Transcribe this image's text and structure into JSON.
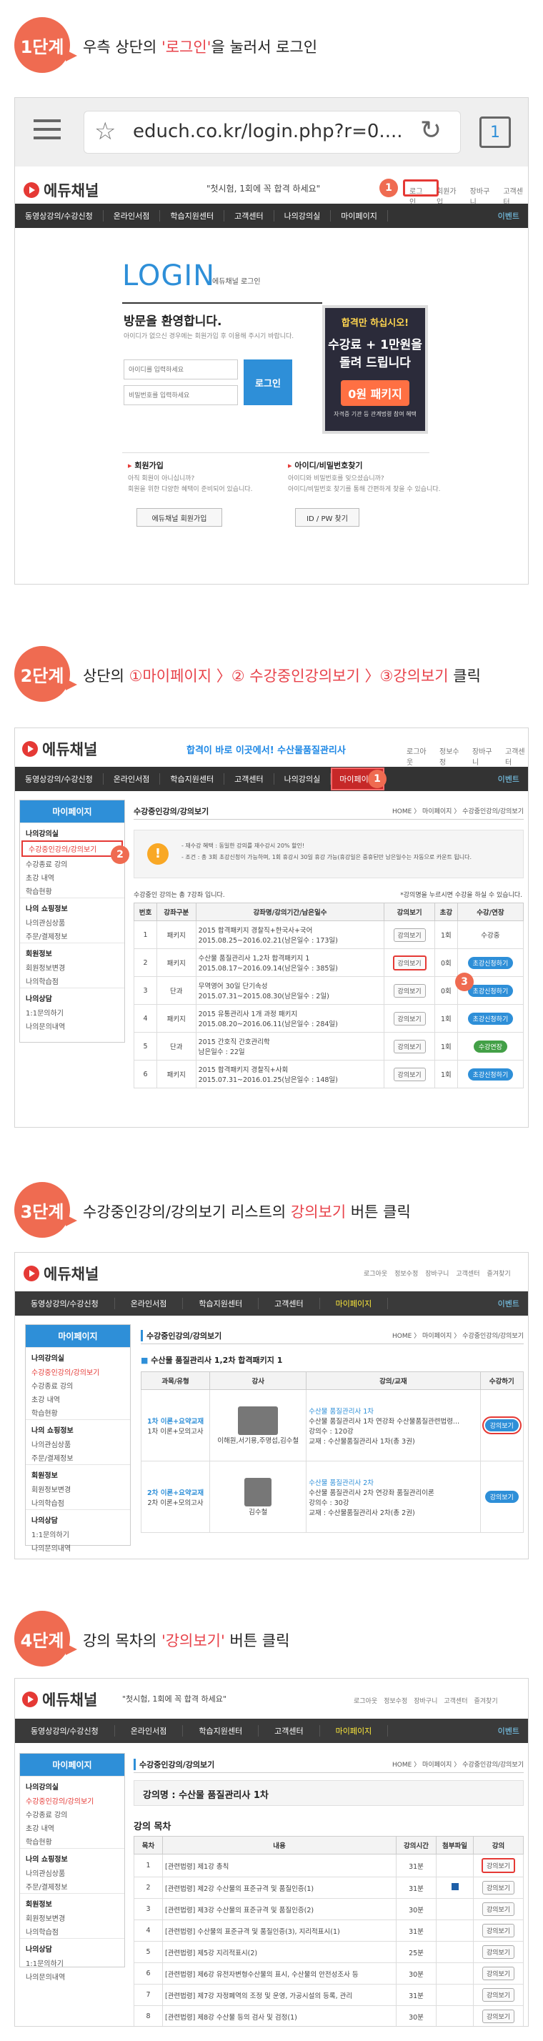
{
  "steps": [
    {
      "num": "1단계",
      "pre": "우측 상단의 ",
      "hl": "'로그인'",
      "post": "을 눌러서 로그인"
    },
    {
      "num": "2단계",
      "pre": "상단의 ",
      "hl": "①마이페이지 〉② 수강중인강의보기 〉③강의보기",
      "post": " 클릭"
    },
    {
      "num": "3단계",
      "pre": "수강중인강의/강의보기 리스트의 ",
      "hl": "강의보기",
      "post": " 버튼 클릭"
    },
    {
      "num": "4단계",
      "pre": "강의 목차의 ",
      "hl": "'강의보기'",
      "post": " 버튼 클릭"
    }
  ],
  "s1": {
    "url": "educh.co.kr/login.php?r=0....",
    "tabcount": "1",
    "logo": "에듀채널",
    "slogan": "\"첫시험, 1회에 꼭 합격 하세요\"",
    "toplinks": [
      "로그인",
      "회원가입",
      "장바구니",
      "고객센터"
    ],
    "nav": [
      "동영상강의/수강신청",
      "온라인서점",
      "학습지원센터",
      "고객센터",
      "나의강의실",
      "마이페이지"
    ],
    "event": "이벤트",
    "login_title": "LOGIN",
    "login_sub": "에듀채널 로그인",
    "welcome": "방문을 환영합니다.",
    "welcome_desc": "아이디가 없으신 경우에는 회원가입 후 이용해 주시기 바랍니다.",
    "id_ph": "아이디를 입력하세요",
    "pw_ph": "비밀번호를 입력하세요",
    "login_btn": "로그인",
    "ad1": "합격만 하십시오!",
    "ad2": "수강료 + 1만원을",
    "ad3": "돌려 드립니다",
    "ad4": "0원 패키지",
    "ad5": "자격증 기관 등\n관계법령 참여 혜택",
    "join_title": "회원가입",
    "join_d1": "아직 회원이 아니십니까?",
    "join_d2": "회원을 위한 다양한 혜택이 준비되어 있습니다.",
    "join_btn": "에듀채널 회원가입",
    "find_title": "아이디/비밀번호찾기",
    "find_d1": "아이디와 비밀번호를 잊으셨습니까?",
    "find_d2": "아이디/비밀번호 찾기를 통해 간편하게 찾을 수 있습니다.",
    "find_btn": "ID / PW 찾기"
  },
  "s2": {
    "logo": "에듀채널",
    "banner": "합격이 바로 이곳에서! 수산물품질관리사",
    "toplinks": [
      "로그아웃",
      "정보수정",
      "장바구니",
      "고객센터"
    ],
    "nav": [
      "동영상강의/수강신청",
      "온라인서점",
      "학습지원센터",
      "고객센터",
      "나의강의실",
      "마이페이지"
    ],
    "event": "이벤트",
    "side_head": "마이페이지",
    "side": [
      {
        "g": "나의강의실",
        "items": [
          "수강중인강의/강의보기",
          "수강종료 강의",
          "초강 내역",
          "학습현황"
        ]
      },
      {
        "g": "나의 쇼핑정보",
        "items": [
          "나의관심상품",
          "주문/결제정보"
        ]
      },
      {
        "g": "회원정보",
        "items": [
          "회원정보변경",
          "나의학습점"
        ]
      },
      {
        "g": "나의상담",
        "items": [
          "1:1문의하기",
          "나의문의내역"
        ]
      }
    ],
    "page_title": "수강중인강의/강의보기",
    "crumb": "HOME 〉 마이페이지 〉 수강중인강의/강의보기",
    "notice1": "- 재수강 혜택 : 동일한 강의를 재수강시 20% 할인!",
    "notice2": "- 조건 : 총 3회 초강신청이 가능하며, 1회 휴강시 30일 휴강 가능(휴강일은 중휴된만 남은일수는 자동으로 카운트 됩니다.",
    "count": "수강중인 강의는 총 7강좌 입니다.",
    "tip": "*강의명을 누르시면 수강을 하실 수 있습니다.",
    "cols": [
      "번호",
      "강좌구분",
      "강좌명/강의기간/남은일수",
      "강의보기",
      "초강",
      "수강/연장"
    ],
    "rows": [
      {
        "n": "1",
        "t": "패키지",
        "name": "2015 합격패키지 경찰직+한국사+국어",
        "period": "2015.08.25~2016.02.21(남은일수 : 173일)",
        "ch": "1회",
        "st": "수강중",
        "kind": "text"
      },
      {
        "n": "2",
        "t": "패키지",
        "name": "수산물 품질관리사 1,2차 합격패키지 1",
        "period": "2015.08.17~2016.09.14(남은일수 : 385일)",
        "ch": "0회",
        "st": "초강신청하기",
        "kind": "blue"
      },
      {
        "n": "3",
        "t": "단과",
        "name": "무역영어 30일 단기속성",
        "period": "2015.07.31~2015.08.30(남은일수 : 2일)",
        "ch": "0회",
        "st": "초강신청하기",
        "kind": "blue"
      },
      {
        "n": "4",
        "t": "패키지",
        "name": "2015 유통관리사 1개 과정 패키지",
        "period": "2015.08.20~2016.06.11(남은일수 : 284일)",
        "ch": "1회",
        "st": "초강신청하기",
        "kind": "blue"
      },
      {
        "n": "5",
        "t": "단과",
        "name": "2015 간호직 간호관리학",
        "period": "남은일수 : 22일",
        "ch": "1회",
        "st": "수강연장",
        "kind": "green"
      },
      {
        "n": "6",
        "t": "패키지",
        "name": "2015 합격패키지 경찰직+사회",
        "period": "2015.07.31~2016.01.25(남은일수 : 148일)",
        "ch": "1회",
        "st": "초강신청하기",
        "kind": "blue"
      }
    ],
    "view_btn": "강의보기"
  },
  "s3": {
    "logo": "에듀채널",
    "toplinks": [
      "로그아웃",
      "정보수정",
      "장바구니",
      "고객센터",
      "즐겨찾기"
    ],
    "nav": [
      "동영상강의/수강신청",
      "온라인서점",
      "학습지원센터",
      "고객센터",
      "마이페이지"
    ],
    "event": "이벤트",
    "page_title": "수강중인강의/강의보기",
    "crumb": "HOME 〉 마이페이지 〉 수강중인강의/강의보기",
    "pkg": "수산물 품질관리사 1,2차 합격패키지 1",
    "cols": [
      "과목/유형",
      "강사",
      "강의/교재",
      "수강하기"
    ],
    "rows": [
      {
        "subj": "1차 이론+요약교재",
        "subj2": "1차 이론+모의고사",
        "teacher": "이해원,서기용,주명섭,김수철",
        "lec": "수산물 품질관리사 1차",
        "lec2": "수산물 품질관리사 1차 연강좌 수산물품질관련법령...",
        "lec3": "강의수 : 120강",
        "lec4": "교재 : 수산물품질관리사 1차(총 3권)"
      },
      {
        "subj": "2차 이론+요약교재",
        "subj2": "2차 이론+모의고사",
        "teacher": "김수철",
        "lec": "수산물 품질관리사 2차",
        "lec2": "수산물 품질관리사 2차 연강좌 품질관리이론",
        "lec3": "강의수 : 30강",
        "lec4": "교재 : 수산물품질관리사 2차(총 2권)"
      }
    ],
    "view_btn": "강의보기"
  },
  "s4": {
    "logo": "에듀채널",
    "slogan": "\"첫시험, 1회에 꼭 합격 하세요\"",
    "toplinks": [
      "로그아웃",
      "정보수정",
      "장바구니",
      "고객센터",
      "즐겨찾기"
    ],
    "nav": [
      "동영상강의/수강신청",
      "온라인서점",
      "학습지원센터",
      "고객센터",
      "마이페이지"
    ],
    "event": "이벤트",
    "page_title": "수강중인강의/강의보기",
    "crumb": "HOME 〉 마이페이지 〉 수강중인강의/강의보기",
    "course": "강의명 : 수산물 품질관리사 1차",
    "toc": "강의 목차",
    "cols": [
      "목차",
      "내용",
      "강의시간",
      "첨부파일",
      "강의"
    ],
    "rows": [
      {
        "n": "1",
        "c": "[관련법령] 제1강 총칙",
        "t": "31분"
      },
      {
        "n": "2",
        "c": "[관련법령] 제2강 수산물의 표준규격 및 품질인증(1)",
        "t": "31분"
      },
      {
        "n": "3",
        "c": "[관련법령] 제3강 수산물의 표준규격 및 품질인증(2)",
        "t": "30분"
      },
      {
        "n": "4",
        "c": "[관련법령] 수산물의 표준규격 및 품질인증(3), 지리적표시(1)",
        "t": "31분"
      },
      {
        "n": "5",
        "c": "[관련법령] 제5강 지리적표시(2)",
        "t": "25분"
      },
      {
        "n": "6",
        "c": "[관련법령] 제6강 유전자변형수산물의 표시, 수산물의 안전성조사 등",
        "t": "30분"
      },
      {
        "n": "7",
        "c": "[관련법령] 제7강 자정폐역의 조정 및 운영, 가공시설의 등록, 관리",
        "t": "31분"
      },
      {
        "n": "8",
        "c": "[관련법령] 제8강 수산물 등의 검사 및 검정(1)",
        "t": "30분"
      }
    ],
    "view_btn": "강의보기"
  }
}
